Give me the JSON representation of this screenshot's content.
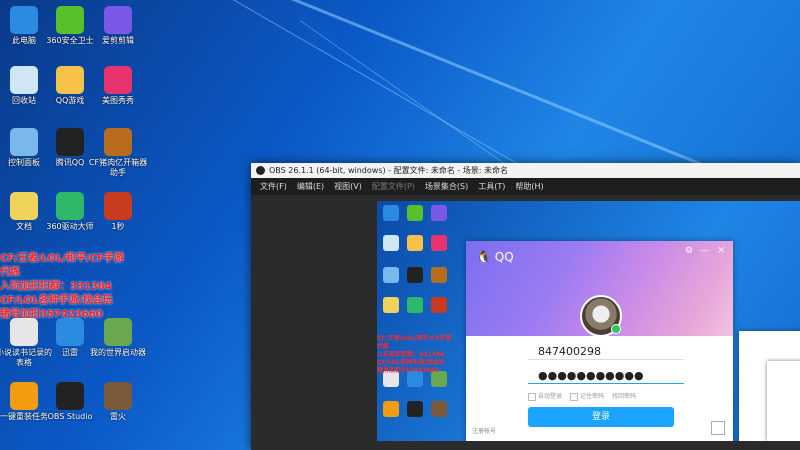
{
  "desktop": {
    "icons": [
      {
        "name": "this-pc-icon",
        "label": "此电脑",
        "color": "#2a8be0"
      },
      {
        "name": "security-icon",
        "label": "360安全卫士",
        "color": "#58c02b"
      },
      {
        "name": "jianying-icon",
        "label": "爱剪剪辑",
        "color": "#7c58e8"
      },
      {
        "name": "recycle-bin-icon",
        "label": "回收站",
        "color": "#cfe6f5"
      },
      {
        "name": "qq-game-icon",
        "label": "QQ游戏",
        "color": "#f6c24a"
      },
      {
        "name": "meitu-icon",
        "label": "美图秀秀",
        "color": "#e8336e"
      },
      {
        "name": "control-panel-icon",
        "label": "控制面板",
        "color": "#7ab7ea"
      },
      {
        "name": "qq-icon",
        "label": "腾讯QQ",
        "color": "#222222"
      },
      {
        "name": "cf-icon",
        "label": "CF猪肉亿开箱器助手",
        "color": "#b86c1e"
      },
      {
        "name": "document-icon",
        "label": "文档",
        "color": "#f0d35a"
      },
      {
        "name": "downloader-icon",
        "label": "360驱动大师",
        "color": "#2fb86a"
      },
      {
        "name": "game-icon",
        "label": "1秒",
        "color": "#c83b1e"
      },
      {
        "name": "doc-file-icon",
        "label": "小说读书记录的表格",
        "color": "#e6e6e6"
      },
      {
        "name": "xunlei-icon",
        "label": "迅雷",
        "color": "#2a8be0"
      },
      {
        "name": "minecraft-icon",
        "label": "我的世界启动器",
        "color": "#6aa84f"
      },
      {
        "name": "flashjet-icon",
        "label": "一键重装任务",
        "color": "#f39c12"
      },
      {
        "name": "obs-icon",
        "label": "OBS Studio",
        "color": "#222222"
      },
      {
        "name": "game2-icon",
        "label": "雷火",
        "color": "#7a5a3a"
      }
    ],
    "promo": {
      "line1": "CF/王者/LOL/和平/CF手游代练",
      "line2": "入坑加扣扣群：331384",
      "line3": "CF/LOL各种手游/找会玩",
      "line4": "猪号加扣357423660"
    }
  },
  "obs": {
    "title": "OBS 26.1.1 (64-bit, windows) - 配置文件: 未命名 - 场景: 未命名",
    "menu": [
      {
        "label": "文件(F)",
        "enabled": true
      },
      {
        "label": "编辑(E)",
        "enabled": true
      },
      {
        "label": "视图(V)",
        "enabled": true
      },
      {
        "label": "配置文件(P)",
        "enabled": false
      },
      {
        "label": "场景集合(S)",
        "enabled": true
      },
      {
        "label": "工具(T)",
        "enabled": true
      },
      {
        "label": "帮助(H)",
        "enabled": true
      }
    ]
  },
  "qq_login": {
    "brand": "QQ",
    "account": "847400298",
    "password_mask": "●●●●●●●●●●●",
    "remember_auto": "自动登录",
    "remember_pw": "记住密码",
    "find_pw": "找回密码",
    "login_label": "登录",
    "register_label": "注册帐号",
    "settings_glyph": "⚙",
    "minimize_glyph": "—"
  }
}
